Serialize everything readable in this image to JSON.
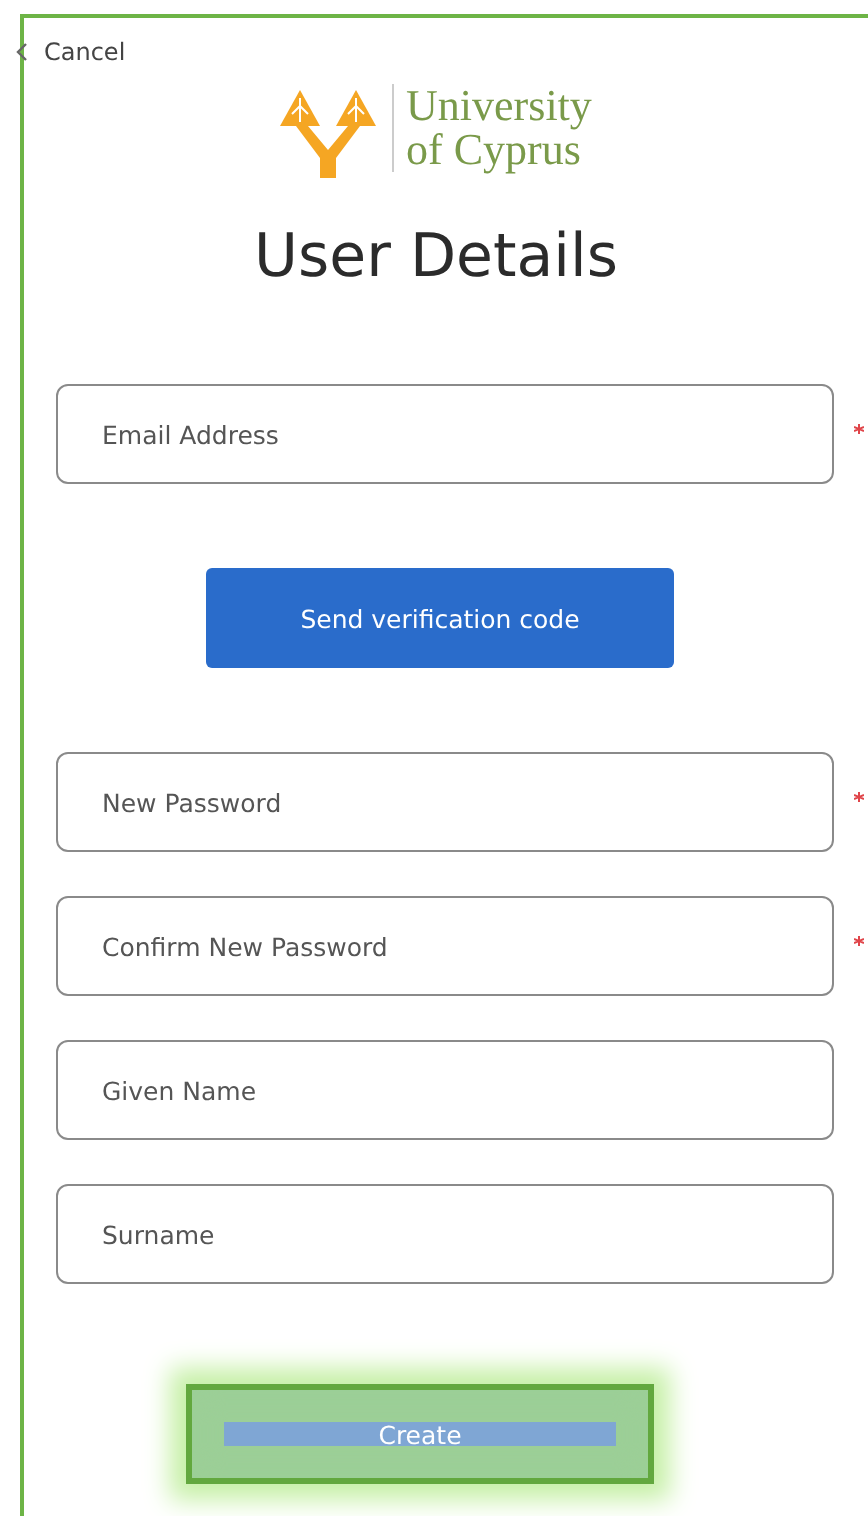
{
  "cancel": {
    "label": "Cancel"
  },
  "logo": {
    "line_1": "University",
    "line_2": "of Cyprus"
  },
  "title": "User Details",
  "fields": [
    {
      "placeholder": "Email Address",
      "required": true
    },
    {
      "kind": "button",
      "label": "Send verification code"
    },
    {
      "placeholder": "New Password",
      "required": true
    },
    {
      "placeholder": "Confirm New Password",
      "required": true
    },
    {
      "placeholder": "Given Name",
      "required": false
    },
    {
      "placeholder": "Surname",
      "required": false
    }
  ],
  "create_button": {
    "label": "Create"
  }
}
